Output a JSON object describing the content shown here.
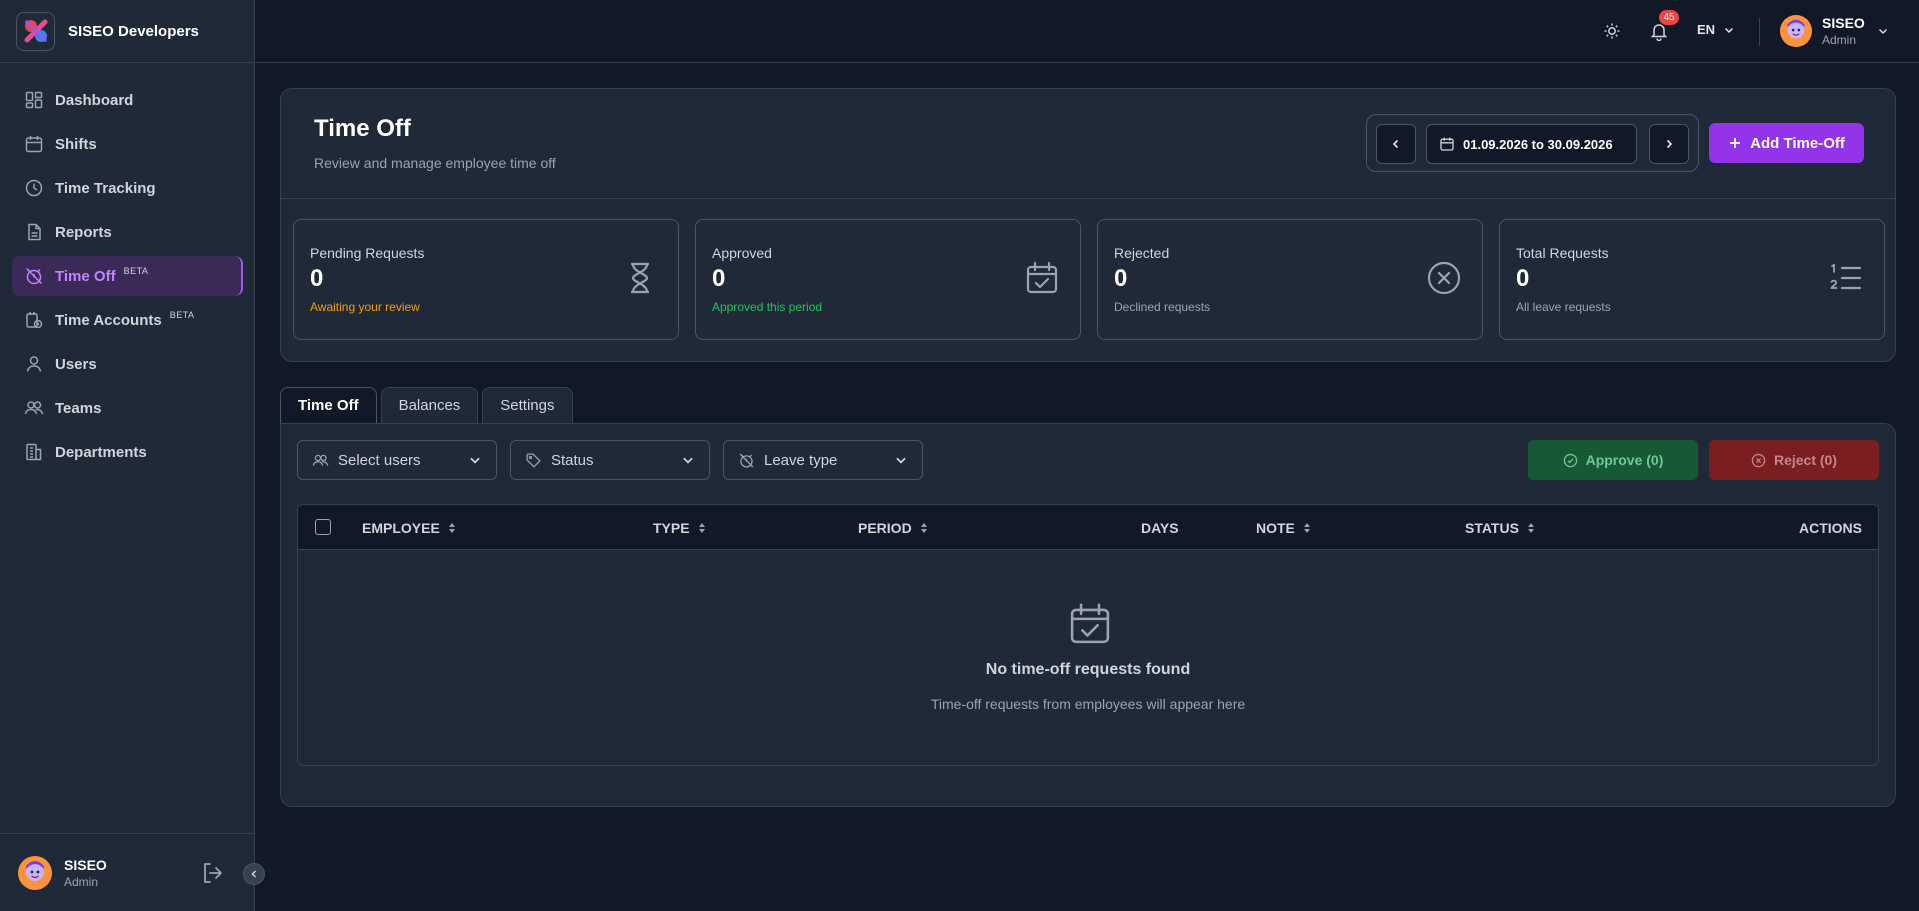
{
  "app": {
    "brand_name": "SISEO Developers"
  },
  "sidebar": {
    "items": [
      {
        "label": "Dashboard",
        "icon": "dashboard-icon"
      },
      {
        "label": "Shifts",
        "icon": "calendar-icon"
      },
      {
        "label": "Time Tracking",
        "icon": "clock-icon"
      },
      {
        "label": "Reports",
        "icon": "report-icon"
      },
      {
        "label": "Time Off",
        "icon": "time-off-icon",
        "badge": "BETA",
        "active": true
      },
      {
        "label": "Time Accounts",
        "icon": "time-accounts-icon",
        "badge": "BETA"
      },
      {
        "label": "Users",
        "icon": "user-icon"
      },
      {
        "label": "Teams",
        "icon": "users-icon"
      },
      {
        "label": "Departments",
        "icon": "building-icon"
      }
    ],
    "footer": {
      "name": "SISEO",
      "role": "Admin"
    }
  },
  "topbar": {
    "notifications_count": "45",
    "language": "EN",
    "user": {
      "name": "SISEO",
      "role": "Admin"
    }
  },
  "header": {
    "title": "Time Off",
    "subtitle": "Review and manage employee time off",
    "date_range": "01.09.2026 to 30.09.2026",
    "add_button": "Add Time-Off"
  },
  "stats": [
    {
      "label": "Pending Requests",
      "value": "0",
      "note": "Awaiting your review",
      "note_color": "#f59e0b",
      "icon": "hourglass-icon"
    },
    {
      "label": "Approved",
      "value": "0",
      "note": "Approved this period",
      "note_color": "#22c55e",
      "icon": "calendar-check-icon"
    },
    {
      "label": "Rejected",
      "value": "0",
      "note": "Declined requests",
      "note_color": "#9ca3af",
      "icon": "x-circle-icon"
    },
    {
      "label": "Total Requests",
      "value": "0",
      "note": "All leave requests",
      "note_color": "#9ca3af",
      "icon": "numbered-list-icon"
    }
  ],
  "tabs": [
    {
      "label": "Time Off",
      "active": true
    },
    {
      "label": "Balances"
    },
    {
      "label": "Settings"
    }
  ],
  "filters": {
    "users_placeholder": "Select users",
    "status_placeholder": "Status",
    "leave_type_placeholder": "Leave type"
  },
  "actions": {
    "approve": "Approve (0)",
    "reject": "Reject (0)"
  },
  "table": {
    "columns": [
      "EMPLOYEE",
      "TYPE",
      "PERIOD",
      "DAYS",
      "NOTE",
      "STATUS",
      "ACTIONS"
    ],
    "empty_title": "No time-off requests found",
    "empty_subtitle": "Time-off requests from employees will appear here"
  },
  "colors": {
    "accent": "#9333ea",
    "background": "#111827",
    "surface": "#1f2937"
  }
}
